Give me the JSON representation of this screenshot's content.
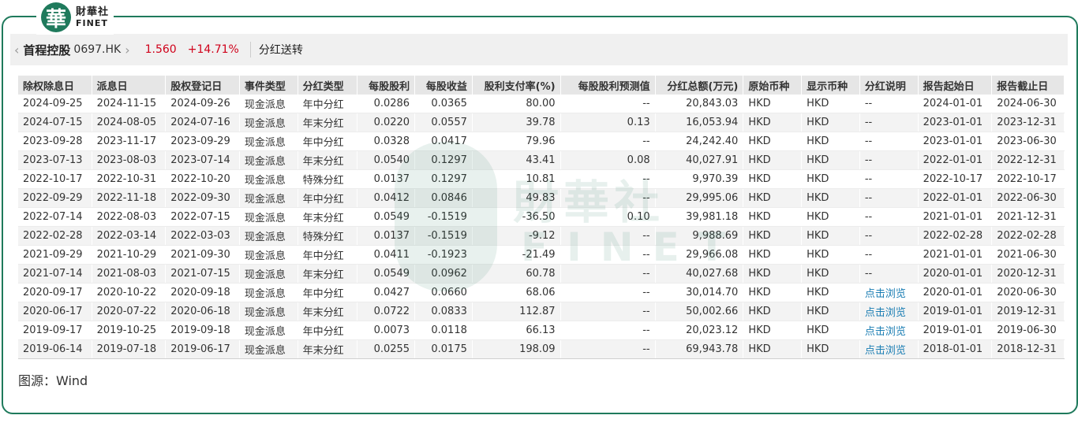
{
  "brand": {
    "logo_char": "華",
    "name_cn": "財華社",
    "name_en": "FINET"
  },
  "header": {
    "prev_icon": "‹",
    "next_icon": "›",
    "stock_name": "首程控股",
    "stock_code": "0697.HK",
    "price": "1.560",
    "change_pct": "+14.71%",
    "tab_label": "分红送转"
  },
  "table": {
    "columns": [
      "除权除息日",
      "派息日",
      "股权登记日",
      "事件类型",
      "分红类型",
      "每股股利",
      "每股收益",
      "股利支付率(%)",
      "每股股利预测值",
      "分红总额(万元)",
      "原始币种",
      "显示币种",
      "分红说明",
      "报告起始日",
      "报告截止日"
    ],
    "rows": [
      [
        "2024-09-25",
        "2024-11-15",
        "2024-09-26",
        "现金派息",
        "年中分红",
        "0.0286",
        "0.0365",
        "80.00",
        "--",
        "20,843.03",
        "HKD",
        "HKD",
        "--",
        "2024-01-01",
        "2024-06-30"
      ],
      [
        "2024-07-15",
        "2024-08-05",
        "2024-07-16",
        "现金派息",
        "年末分红",
        "0.0220",
        "0.0557",
        "39.78",
        "0.13",
        "16,053.94",
        "HKD",
        "HKD",
        "--",
        "2023-01-01",
        "2023-12-31"
      ],
      [
        "2023-09-28",
        "2023-11-17",
        "2023-09-29",
        "现金派息",
        "年中分红",
        "0.0328",
        "0.0417",
        "79.96",
        "--",
        "24,242.40",
        "HKD",
        "HKD",
        "--",
        "2023-01-01",
        "2023-06-30"
      ],
      [
        "2023-07-13",
        "2023-08-03",
        "2023-07-14",
        "现金派息",
        "年末分红",
        "0.0540",
        "0.1297",
        "43.41",
        "0.08",
        "40,027.91",
        "HKD",
        "HKD",
        "--",
        "2022-01-01",
        "2022-12-31"
      ],
      [
        "2022-10-17",
        "2022-10-31",
        "2022-10-20",
        "现金派息",
        "特殊分红",
        "0.0137",
        "0.1297",
        "10.81",
        "--",
        "9,970.39",
        "HKD",
        "HKD",
        "--",
        "2022-10-17",
        "2022-10-17"
      ],
      [
        "2022-09-29",
        "2022-11-18",
        "2022-09-30",
        "现金派息",
        "年中分红",
        "0.0412",
        "0.0846",
        "49.83",
        "--",
        "29,995.06",
        "HKD",
        "HKD",
        "--",
        "2022-01-01",
        "2022-06-30"
      ],
      [
        "2022-07-14",
        "2022-08-03",
        "2022-07-15",
        "现金派息",
        "年末分红",
        "0.0549",
        "-0.1519",
        "-36.50",
        "0.10",
        "39,981.18",
        "HKD",
        "HKD",
        "--",
        "2021-01-01",
        "2021-12-31"
      ],
      [
        "2022-02-28",
        "2022-03-14",
        "2022-03-03",
        "现金派息",
        "特殊分红",
        "0.0137",
        "-0.1519",
        "-9.12",
        "--",
        "9,988.69",
        "HKD",
        "HKD",
        "--",
        "2022-02-28",
        "2022-02-28"
      ],
      [
        "2021-09-29",
        "2021-10-29",
        "2021-09-30",
        "现金派息",
        "年中分红",
        "0.0411",
        "-0.1923",
        "-21.49",
        "--",
        "29,966.08",
        "HKD",
        "HKD",
        "--",
        "2021-01-01",
        "2021-06-30"
      ],
      [
        "2021-07-14",
        "2021-08-03",
        "2021-07-15",
        "现金派息",
        "年末分红",
        "0.0549",
        "0.0962",
        "60.78",
        "--",
        "40,027.68",
        "HKD",
        "HKD",
        "--",
        "2020-01-01",
        "2020-12-31"
      ],
      [
        "2020-09-17",
        "2020-10-22",
        "2020-09-18",
        "现金派息",
        "年中分红",
        "0.0427",
        "0.0660",
        "68.06",
        "--",
        "30,014.70",
        "HKD",
        "HKD",
        "点击浏览",
        "2020-01-01",
        "2020-06-30"
      ],
      [
        "2020-06-17",
        "2020-07-22",
        "2020-06-18",
        "现金派息",
        "年末分红",
        "0.0722",
        "0.0833",
        "112.87",
        "--",
        "50,002.66",
        "HKD",
        "HKD",
        "点击浏览",
        "2019-01-01",
        "2019-12-31"
      ],
      [
        "2019-09-17",
        "2019-10-25",
        "2019-09-18",
        "现金派息",
        "年中分红",
        "0.0073",
        "0.0118",
        "66.13",
        "--",
        "20,023.12",
        "HKD",
        "HKD",
        "点击浏览",
        "2019-01-01",
        "2019-06-30"
      ],
      [
        "2019-06-14",
        "2019-07-18",
        "2019-06-17",
        "现金派息",
        "年末分红",
        "0.0255",
        "0.0175",
        "198.09",
        "--",
        "69,943.78",
        "HKD",
        "HKD",
        "点击浏览",
        "2018-01-01",
        "2018-12-31"
      ]
    ]
  },
  "watermark": {
    "cn": "財華社",
    "en": "FINET"
  },
  "footer": {
    "source": "图源：Wind"
  },
  "colors": {
    "brand": "#1f7a5c",
    "up": "#d0021b",
    "link": "#1a7db3"
  }
}
